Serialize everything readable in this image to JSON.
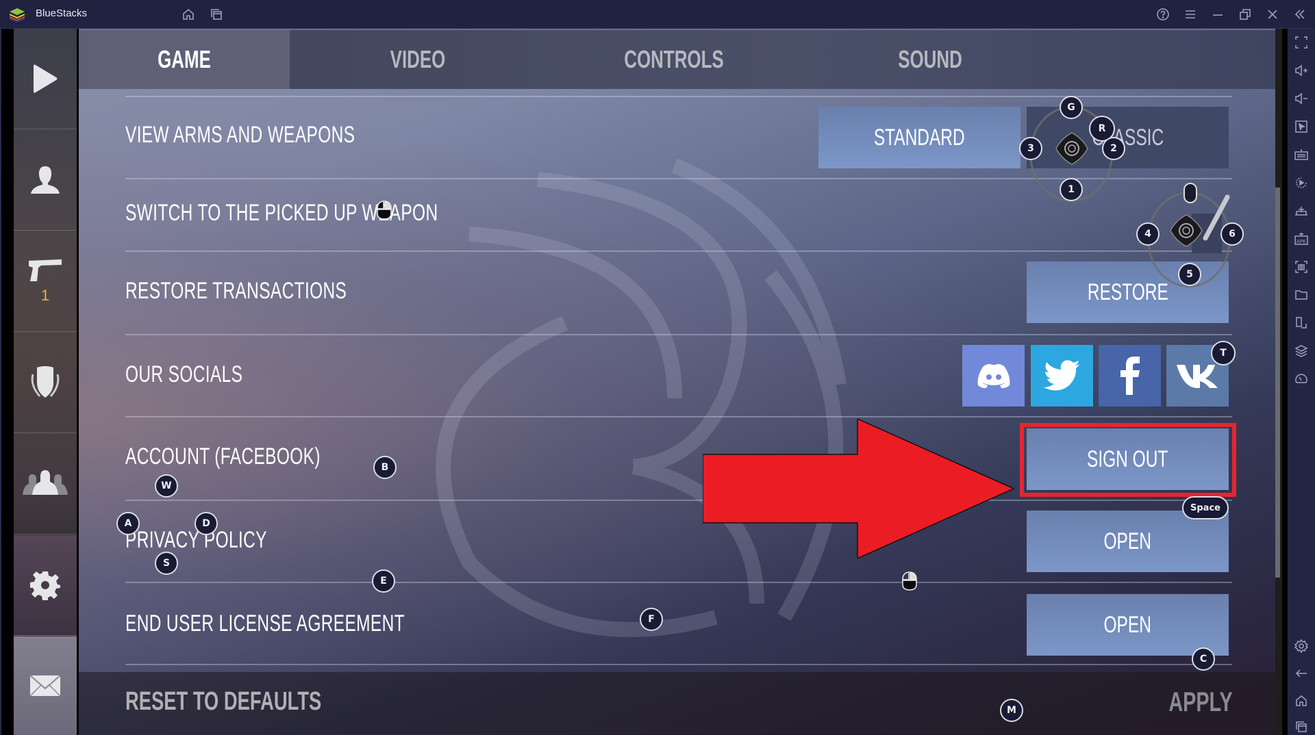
{
  "window": {
    "title": "BlueStacks",
    "titlebar_icons": [
      "home-icon",
      "multi-instance-icon"
    ],
    "controls": [
      "help-icon",
      "menu-icon",
      "minimize-icon",
      "restore-icon",
      "close-icon",
      "collapse-sidebar-icon"
    ]
  },
  "right_toolbar": {
    "icons": [
      "fullscreen-icon",
      "volume-up-icon",
      "volume-down-icon",
      "pointer-icon",
      "keyboard-icon",
      "macro-icon",
      "install-apk-bundle-icon",
      "apk-icon",
      "screenshot-icon",
      "folder-icon",
      "rotate-icon",
      "layers-icon",
      "eco-mode-icon"
    ],
    "bottom_icons": [
      "settings-icon",
      "back-icon",
      "home-icon",
      "recent-apps-icon"
    ]
  },
  "side_nav": {
    "items": [
      {
        "name": "play",
        "icon": "play-icon"
      },
      {
        "name": "profile",
        "icon": "profile-icon"
      },
      {
        "name": "weapons",
        "icon": "pistol-icon",
        "badge": "1"
      },
      {
        "name": "clan",
        "icon": "shield-icon"
      },
      {
        "name": "friends",
        "icon": "friends-icon"
      },
      {
        "name": "settings",
        "icon": "gear-icon",
        "active": true
      },
      {
        "name": "mail",
        "icon": "mail-icon"
      }
    ]
  },
  "tabs": [
    {
      "label": "GAME",
      "active": true
    },
    {
      "label": "VIDEO",
      "active": false
    },
    {
      "label": "CONTROLS",
      "active": false
    },
    {
      "label": "SOUND",
      "active": false
    }
  ],
  "settings": {
    "view_arms": {
      "label": "VIEW ARMS AND WEAPONS",
      "options": [
        "STANDARD",
        "CLASSIC"
      ],
      "selected": "STANDARD"
    },
    "switch_weapon": {
      "label": "SWITCH TO THE PICKED UP WEAPON",
      "enabled": true
    },
    "restore": {
      "label": "RESTORE TRANSACTIONS",
      "button": "RESTORE"
    },
    "socials": {
      "label": "OUR SOCIALS",
      "links": [
        "discord",
        "twitter",
        "facebook",
        "vk"
      ]
    },
    "account": {
      "label": "ACCOUNT (FACEBOOK)",
      "button": "SIGN OUT"
    },
    "privacy": {
      "label": "PRIVACY POLICY",
      "button": "OPEN"
    },
    "eula": {
      "label": "END USER LICENSE AGREEMENT",
      "button": "OPEN"
    }
  },
  "footer": {
    "reset": "RESET TO DEFAULTS",
    "apply": "APPLY"
  },
  "keymap": {
    "dpad1": {
      "top": "G",
      "left": "3",
      "right": "2",
      "bottom": "1",
      "extra": "R"
    },
    "dpad2": {
      "left": "4",
      "right": "6",
      "bottom": "5"
    },
    "keys": {
      "T": "T",
      "B": "B",
      "W": "W",
      "A": "A",
      "D": "D",
      "S": "S",
      "E": "E",
      "F": "F",
      "C": "C",
      "M": "M",
      "Space": "Space"
    }
  },
  "annotation": {
    "arrow_color": "#ec1c24",
    "highlight_color": "#e52530"
  },
  "colors": {
    "button": "#7188b8",
    "discord": "#7289da",
    "twitter": "#2ca7e0",
    "facebook": "#4765a8",
    "vk": "#5b7aa8",
    "badge": "#f0b13a"
  }
}
